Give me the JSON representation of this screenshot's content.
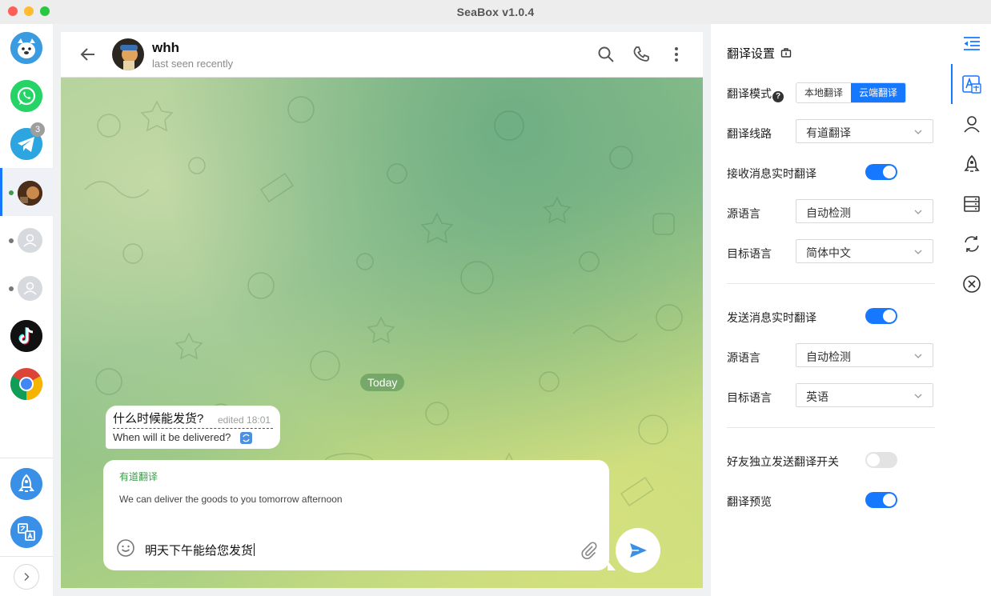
{
  "window": {
    "title": "SeaBox v1.0.4"
  },
  "rail": {
    "apps": [
      {
        "name": "seabox",
        "color": "#3a9be0"
      },
      {
        "name": "whatsapp",
        "color": "#25d366"
      },
      {
        "name": "telegram",
        "color": "#2ca5e0",
        "badge": "3"
      },
      {
        "name": "tiktok",
        "color": "#111111"
      },
      {
        "name": "chrome",
        "color": "#4285f4"
      }
    ],
    "accounts": [
      {
        "status_color": "#3c9a4a"
      },
      {
        "status_color": "#777777"
      },
      {
        "status_color": "#777777"
      }
    ],
    "bottom_icons": [
      "rocket-icon",
      "translate-icon"
    ]
  },
  "chat": {
    "peer_name": "whh",
    "peer_status": "last seen recently",
    "date_chip": "Today",
    "message": {
      "original": "什么时候能发货?",
      "edited": "edited 18:01",
      "translation": "When will it be delivered?"
    },
    "compose": {
      "translator": "有道翻译",
      "translation_preview": "We can deliver the goods to you tomorrow afternoon",
      "input_value": "明天下午能给您发货"
    }
  },
  "settings": {
    "title": "翻译设置",
    "mode_label": "翻译模式",
    "mode_options": [
      "本地翻译",
      "云端翻译"
    ],
    "mode_selected": "云端翻译",
    "route_label": "翻译线路",
    "route_value": "有道翻译",
    "receive_label": "接收消息实时翻译",
    "receive_on": true,
    "receive_src_label": "源语言",
    "receive_src_value": "自动检测",
    "receive_tgt_label": "目标语言",
    "receive_tgt_value": "简体中文",
    "send_label": "发送消息实时翻译",
    "send_on": true,
    "send_src_label": "源语言",
    "send_src_value": "自动检测",
    "send_tgt_label": "目标语言",
    "send_tgt_value": "英语",
    "friend_label": "好友独立发送翻译开关",
    "friend_on": false,
    "preview_label": "翻译预览",
    "preview_on": true
  },
  "right_icons": [
    "collapse-icon",
    "translate-icon",
    "user-icon",
    "rocket-icon",
    "database-icon",
    "refresh-icon",
    "close-circle-icon"
  ],
  "colors": {
    "accent": "#1677ff",
    "chat_accent": "#3c9a4a"
  }
}
